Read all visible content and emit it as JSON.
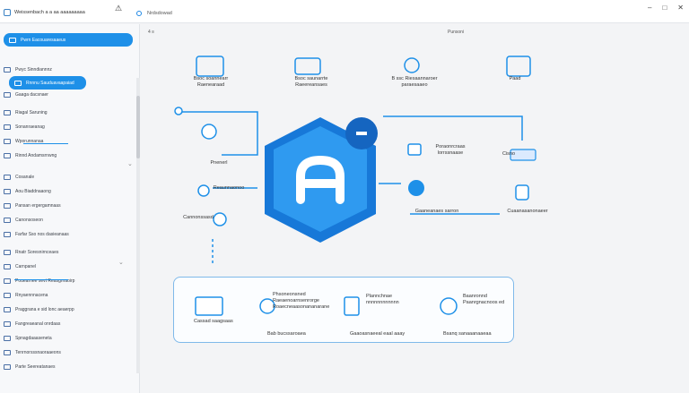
{
  "window": {
    "tab_title": "Weissenbach a a aa aaaaaaaaa",
    "address_label": "Nrdsdowad",
    "header_right": "Punsoni",
    "header_mid": "4 ≡"
  },
  "sidebar": {
    "items": [
      {
        "label": "Pwrn Eacouaresaaeus",
        "active": true
      },
      {
        "label": "Pwyc Sinndiannnz",
        "active": false
      },
      {
        "label": "Rnnnu Sauduavaapaiad",
        "active": true
      },
      {
        "label": "Gaaga dacsnaer",
        "active": false
      },
      {
        "label": "Riagal Saruning",
        "active": false
      },
      {
        "label": "Sonanraeanag",
        "active": false
      },
      {
        "label": "Wporunnanaa",
        "active": false
      },
      {
        "label": "Rinnd Andamsrnwng",
        "active": false
      },
      {
        "label": "Cosanale",
        "active": false
      },
      {
        "label": "Aou Biaddnaaong",
        "active": false
      },
      {
        "label": "Pansan ergergamnaas",
        "active": false
      },
      {
        "label": "Canonsoseon",
        "active": false
      },
      {
        "label": "Farfar Sso nos dasieanaas",
        "active": false
      },
      {
        "label": "Rnatr Soresnirnceaes",
        "active": false
      },
      {
        "label": "Carnpanel",
        "active": false
      },
      {
        "label": "Pouearnee sevt Reasgrnaoirp",
        "active": false
      },
      {
        "label": "Rnyaennnacena",
        "active": false
      },
      {
        "label": "Praggrana e sid lonc aeaerpp",
        "active": false
      },
      {
        "label": "Fangreaeanal onrdaas",
        "active": false
      },
      {
        "label": "Spnagdaaaseneta",
        "active": false
      },
      {
        "label": "Tenrnorsssnaoraaeons",
        "active": false
      },
      {
        "label": "Parte Seereatanaes",
        "active": false
      }
    ]
  },
  "canvas": {
    "top_labels": [
      "Bsoc soannearr\nRaenearaad",
      "Bsoc saunarrte\nRaeereansaes",
      "B ssc Riesaannaroer\nparaesaaeo",
      "Paad"
    ],
    "mid_labels": [
      "Poraonrcraas\nlorrssnaase",
      "Cisno",
      "Pnenerl",
      "Cannonssasd",
      "Gaaneanaes sarron",
      "Cuaanasanonaeer",
      "Reaunnaonoo"
    ],
    "logo_letter": "A",
    "badge_symbol": "–"
  },
  "bottom_panel": {
    "items": [
      {
        "title": "",
        "caption": "Cassad saagsaas"
      },
      {
        "title": "Phsoneonsned\nRaeaenoarnsenrorge\nRoaecneaasonananarane",
        "caption": "Bab bucssaroaea"
      },
      {
        "title": "Plannchnae\nnnnnnnnnnnnn",
        "caption": "Gaaoasnaeeal eaal aaay"
      },
      {
        "title": "Baanronnd\nPaanrgnacnoos ed",
        "caption": "Bsanq sanaaanaaeaa"
      }
    ]
  },
  "colors": {
    "accent": "#1e90e8",
    "logo": "#1778d8",
    "bg": "#f3f4f6"
  }
}
